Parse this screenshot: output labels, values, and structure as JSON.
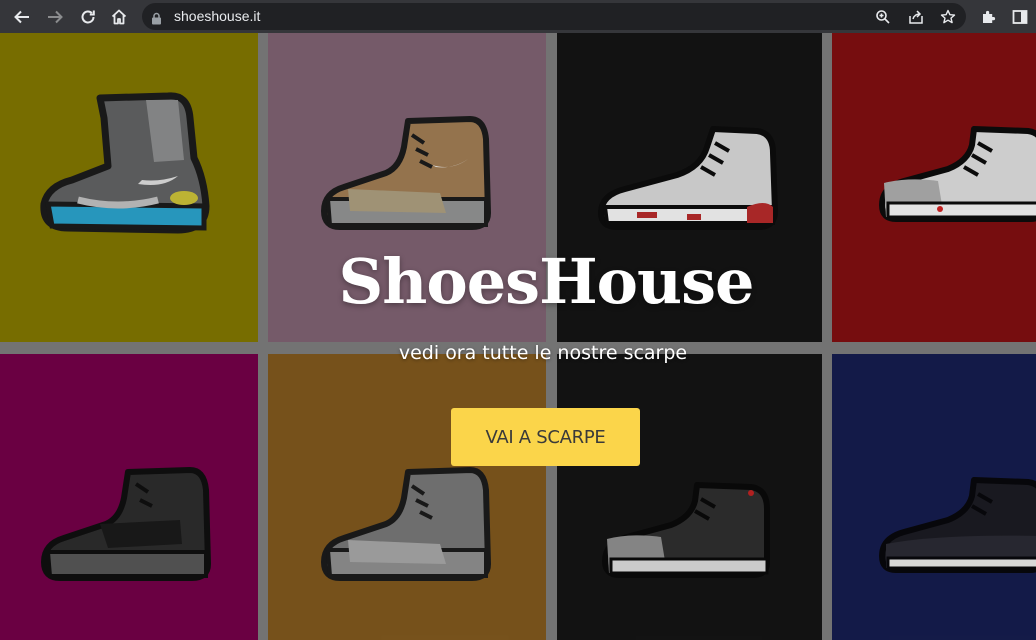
{
  "browser": {
    "url": "shoeshouse.it"
  },
  "hero": {
    "title": "ShoesHouse",
    "subtitle": "vedi ora tutte le nostre scarpe",
    "cta_label": "VAI A SCARPE"
  },
  "tiles": [
    {
      "bg": "#7e7300",
      "shoe": "mag"
    },
    {
      "bg": "#7c5f6f",
      "shoe": "yeezy-tan"
    },
    {
      "bg": "#141414",
      "shoe": "jordan-6-infrared"
    },
    {
      "bg": "#7d0e10",
      "shoe": "jordan-3-white-cement"
    },
    {
      "bg": "#700046",
      "shoe": "yeezy-black"
    },
    {
      "bg": "#7d561d",
      "shoe": "yeezy-grey"
    },
    {
      "bg": "#141414",
      "shoe": "jordan-3-black-cement"
    },
    {
      "bg": "#151c4c",
      "shoe": "jordan-11-space-jam"
    }
  ],
  "colors": {
    "cta": "#fbd54a",
    "tile_gap": "#7a7a7a"
  }
}
